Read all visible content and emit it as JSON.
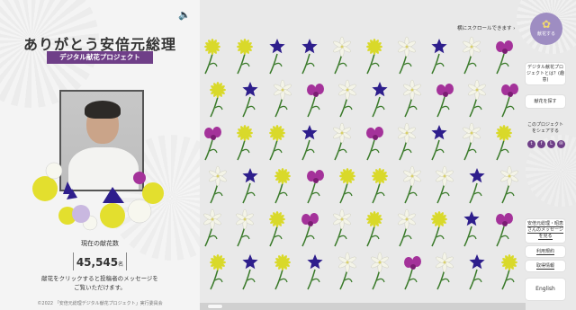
{
  "left": {
    "title": "ありがとう安倍元総理",
    "subtitle": "デジタル献花プロジェクト",
    "count_label": "現在の献花数",
    "count_value": "45,545",
    "count_unit": "名",
    "message_line1": "献花をクリックすると投稿者のメッセージを",
    "message_line2": "ご覧いただけます。",
    "copyright": "©2022 「安倍元総理デジタル献花プロジェクト」実行委員会"
  },
  "main": {
    "scroll_hint": "横にスクロールできます ›",
    "flower_colors": {
      "chrysanthemum": "#d9d92a",
      "bellflower": "#2e1e8c",
      "lily": "#f4f4e8",
      "orchid": "#a4329a",
      "stem": "#3a7a2a"
    }
  },
  "sidebar": {
    "offer_label": "献花する",
    "about_label": "デジタル献花プロジェクトとは？(趣意)",
    "find_label": "献花を探す",
    "share_label": "このプロジェクトをシェアする",
    "share_icons": [
      "twitter-icon",
      "facebook-icon",
      "line-icon",
      "mail-icon"
    ],
    "message_label": "安倍元総理・昭恵さんのメッセージを見る",
    "terms_label": "利用規約",
    "privacy_label": "取得情報",
    "english_label": "English"
  }
}
